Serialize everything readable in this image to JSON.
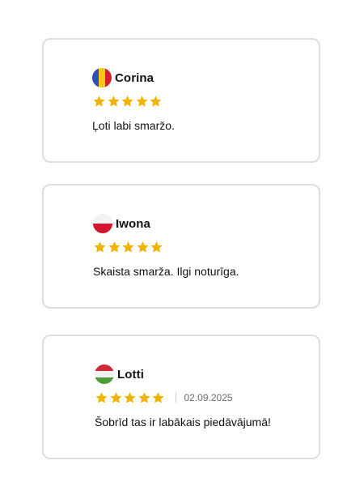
{
  "colors": {
    "card_border": "#dedede",
    "star": "#f0b400",
    "date_text": "#6b6b6b"
  },
  "reviews": [
    {
      "name": "Corina",
      "flag": "romania-flag-icon",
      "rating": 5,
      "text": "Ļoti labi smaržo."
    },
    {
      "name": "Iwona",
      "flag": "poland-flag-icon",
      "rating": 5,
      "text": "Skaista smarža. Ilgi noturīga."
    },
    {
      "name": "Lotti",
      "flag": "hungary-flag-icon",
      "rating": 5,
      "date": "02.09.2025",
      "text": "Šobrīd tas ir labākais piedāvājumā!"
    }
  ]
}
